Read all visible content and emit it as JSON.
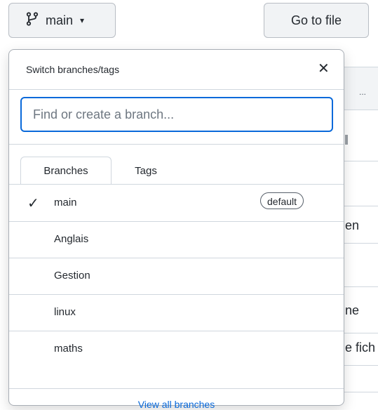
{
  "header": {
    "branch_button_label": "main",
    "goto_file_label": "Go to file"
  },
  "background": {
    "dots": "...",
    "fragments": [
      "en",
      "ne",
      "e fich"
    ]
  },
  "dropdown": {
    "title": "Switch branches/tags",
    "search_placeholder": "Find or create a branch...",
    "tabs": [
      {
        "label": "Branches",
        "active": true
      },
      {
        "label": "Tags",
        "active": false
      }
    ],
    "branches": [
      {
        "name": "main",
        "selected": true,
        "badge": "default"
      },
      {
        "name": "Anglais",
        "selected": false
      },
      {
        "name": "Gestion",
        "selected": false
      },
      {
        "name": "linux",
        "selected": false
      },
      {
        "name": "maths",
        "selected": false
      }
    ],
    "view_all_label": "View all branches"
  },
  "colors": {
    "accent": "#0969da",
    "border": "#d0d7de"
  }
}
